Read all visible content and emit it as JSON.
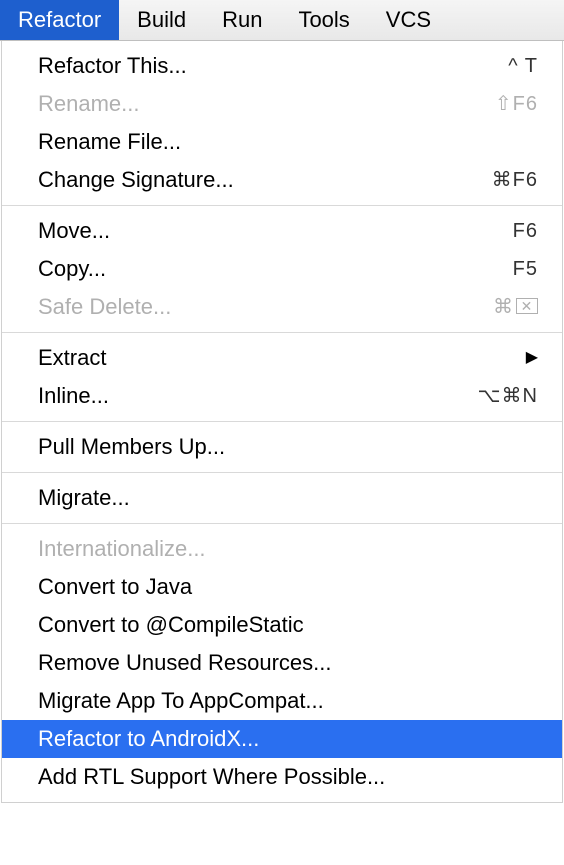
{
  "menubar": {
    "items": [
      {
        "label": "Refactor",
        "active": true
      },
      {
        "label": "Build",
        "active": false
      },
      {
        "label": "Run",
        "active": false
      },
      {
        "label": "Tools",
        "active": false
      },
      {
        "label": "VCS",
        "active": false
      }
    ]
  },
  "dropdown": {
    "sections": [
      [
        {
          "label": "Refactor This...",
          "shortcut": "^ T",
          "disabled": false
        },
        {
          "label": "Rename...",
          "shortcut": "⇧F6",
          "disabled": true
        },
        {
          "label": "Rename File...",
          "shortcut": "",
          "disabled": false
        },
        {
          "label": "Change Signature...",
          "shortcut": "⌘F6",
          "disabled": false
        }
      ],
      [
        {
          "label": "Move...",
          "shortcut": "F6",
          "disabled": false
        },
        {
          "label": "Copy...",
          "shortcut": "F5",
          "disabled": false
        },
        {
          "label": "Safe Delete...",
          "shortcut": "⌘⌦",
          "disabled": true,
          "deleteIcon": true
        }
      ],
      [
        {
          "label": "Extract",
          "shortcut": "",
          "disabled": false,
          "submenu": true
        },
        {
          "label": "Inline...",
          "shortcut": "⌥⌘N",
          "disabled": false
        }
      ],
      [
        {
          "label": "Pull Members Up...",
          "shortcut": "",
          "disabled": false
        }
      ],
      [
        {
          "label": "Migrate...",
          "shortcut": "",
          "disabled": false
        }
      ],
      [
        {
          "label": "Internationalize...",
          "shortcut": "",
          "disabled": true
        },
        {
          "label": "Convert to Java",
          "shortcut": "",
          "disabled": false
        },
        {
          "label": "Convert to @CompileStatic",
          "shortcut": "",
          "disabled": false
        },
        {
          "label": "Remove Unused Resources...",
          "shortcut": "",
          "disabled": false
        },
        {
          "label": "Migrate App To AppCompat...",
          "shortcut": "",
          "disabled": false
        },
        {
          "label": "Refactor to AndroidX...",
          "shortcut": "",
          "disabled": false,
          "highlighted": true
        },
        {
          "label": "Add RTL Support Where Possible...",
          "shortcut": "",
          "disabled": false
        }
      ]
    ]
  }
}
